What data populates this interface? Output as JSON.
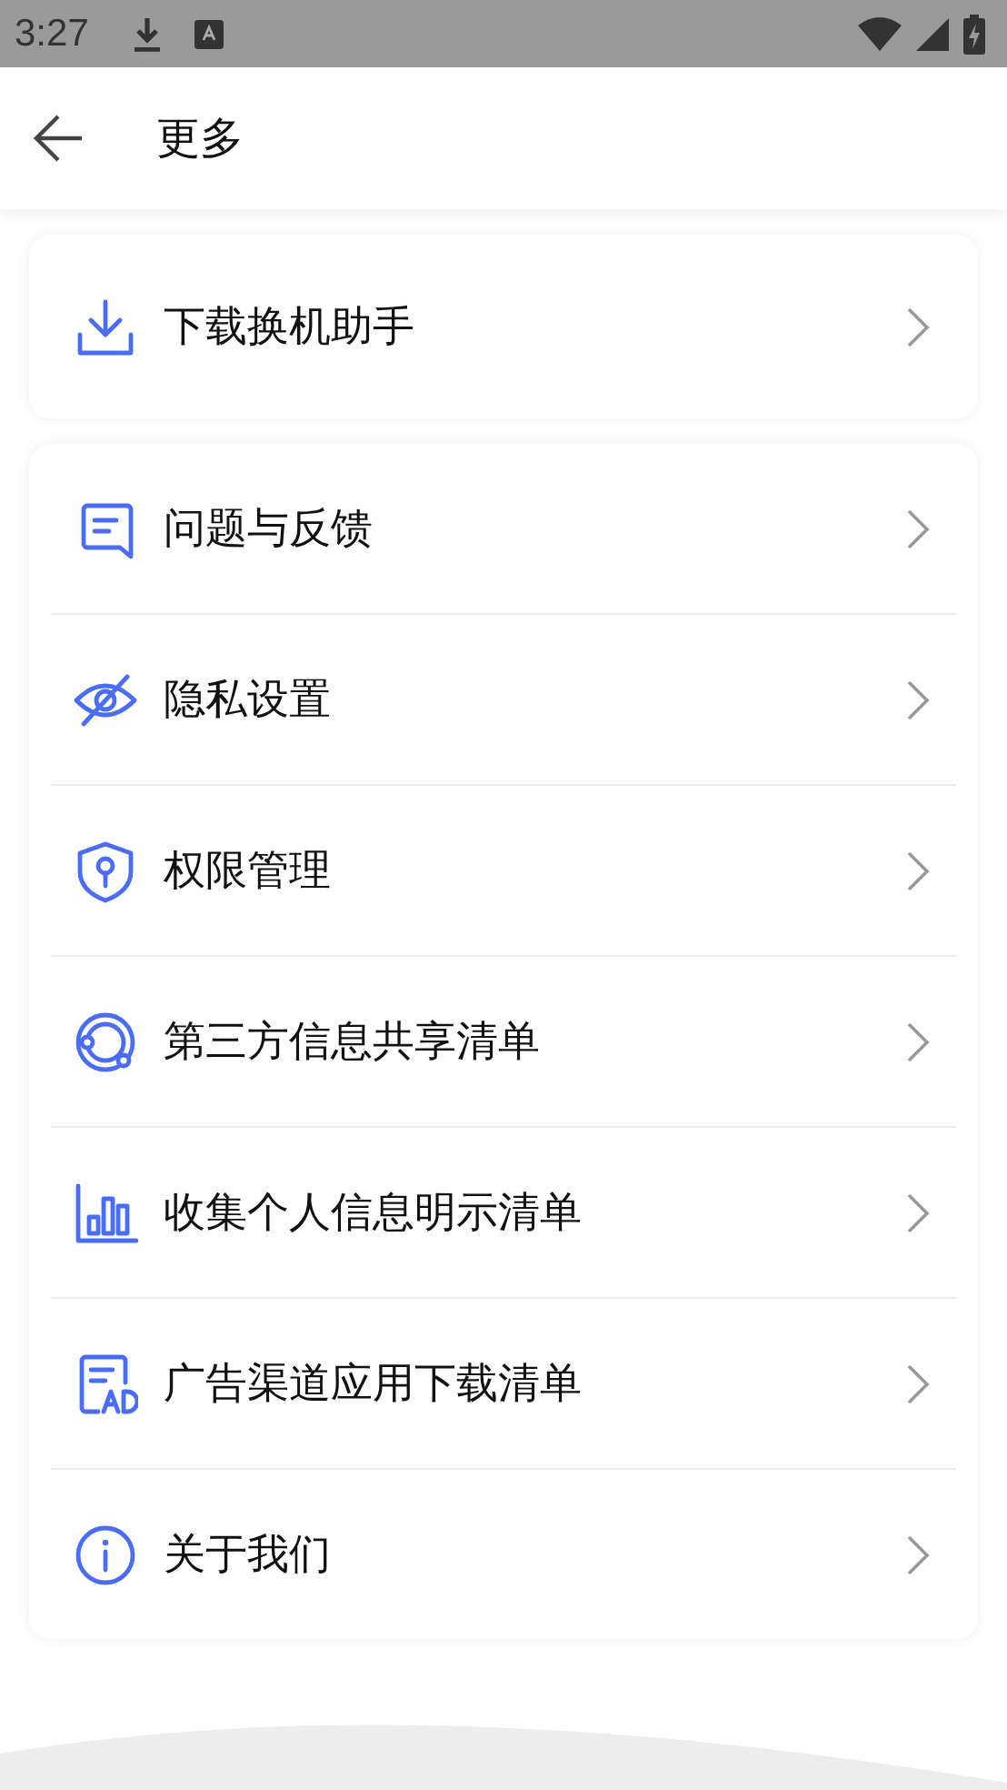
{
  "status_bar": {
    "time": "3:27"
  },
  "header": {
    "title": "更多"
  },
  "groups": [
    {
      "items": [
        {
          "kind": "download",
          "label": "下载换机助手"
        }
      ]
    },
    {
      "items": [
        {
          "kind": "feedback",
          "label": "问题与反馈"
        },
        {
          "kind": "privacy",
          "label": "隐私设置"
        },
        {
          "kind": "permission",
          "label": "权限管理"
        },
        {
          "kind": "share",
          "label": "第三方信息共享清单"
        },
        {
          "kind": "collect",
          "label": "收集个人信息明示清单"
        },
        {
          "kind": "ad",
          "label": "广告渠道应用下载清单"
        },
        {
          "kind": "about",
          "label": "关于我们"
        }
      ]
    }
  ]
}
